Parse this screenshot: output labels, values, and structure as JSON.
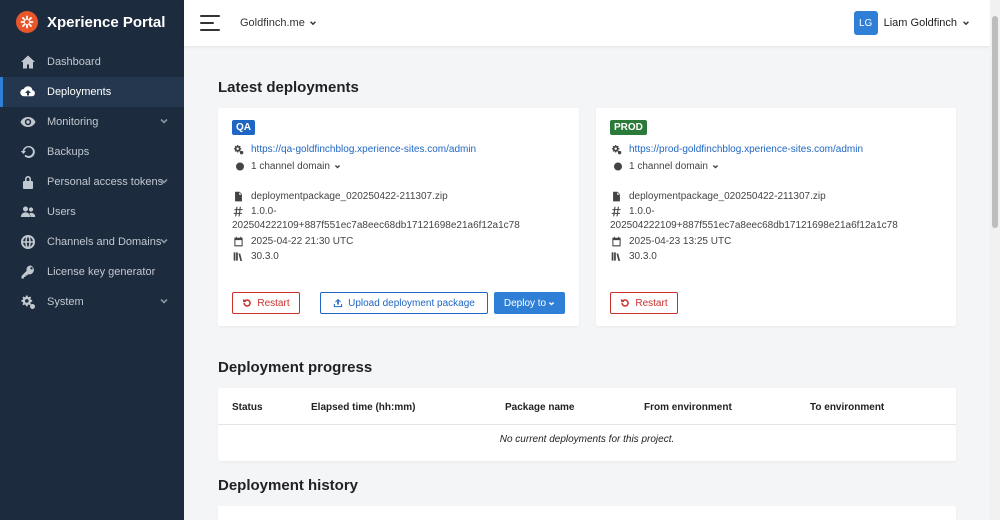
{
  "app": {
    "title": "Xperience Portal"
  },
  "sidebar": {
    "items": [
      {
        "label": "Dashboard",
        "icon": "home-icon",
        "active": false,
        "expandable": false
      },
      {
        "label": "Deployments",
        "icon": "cloud-upload-icon",
        "active": true,
        "expandable": false
      },
      {
        "label": "Monitoring",
        "icon": "eye-icon",
        "active": false,
        "expandable": true
      },
      {
        "label": "Backups",
        "icon": "restore-icon",
        "active": false,
        "expandable": false
      },
      {
        "label": "Personal access tokens",
        "icon": "lock-icon",
        "active": false,
        "expandable": true
      },
      {
        "label": "Users",
        "icon": "users-icon",
        "active": false,
        "expandable": false
      },
      {
        "label": "Channels and Domains",
        "icon": "globe-icon",
        "active": false,
        "expandable": true
      },
      {
        "label": "License key generator",
        "icon": "key-icon",
        "active": false,
        "expandable": false
      },
      {
        "label": "System",
        "icon": "gears-icon",
        "active": false,
        "expandable": true
      }
    ]
  },
  "topbar": {
    "project": "Goldfinch.me",
    "user_initials": "LG",
    "user_name": "Liam Goldfinch"
  },
  "deployments": {
    "title": "Latest deployments",
    "environments": [
      {
        "badge": "QA",
        "admin_url": "https://qa-goldfinchblog.xperience-sites.com/admin",
        "domains": "1 channel domain",
        "package": "deploymentpackage_020250422-211307.zip",
        "version_line1": "1.0.0-",
        "version_line2": "202504222109+887f551ec7a8eec68db17121698e21a6f12a1c78",
        "date": "2025-04-22 21:30 UTC",
        "xp_version": "30.3.0",
        "restart_label": "Restart",
        "upload_label": "Upload deployment package",
        "deploy_label": "Deploy to"
      },
      {
        "badge": "PROD",
        "admin_url": "https://prod-goldfinchblog.xperience-sites.com/admin",
        "domains": "1 channel domain",
        "package": "deploymentpackage_020250422-211307.zip",
        "version_line1": "1.0.0-",
        "version_line2": "202504222109+887f551ec7a8eec68db17121698e21a6f12a1c78",
        "date": "2025-04-23 13:25 UTC",
        "xp_version": "30.3.0",
        "restart_label": "Restart"
      }
    ]
  },
  "progress": {
    "title": "Deployment progress",
    "columns": [
      "Status",
      "Elapsed time (hh:mm)",
      "Package name",
      "From environment",
      "To environment"
    ],
    "empty_message": "No current deployments for this project."
  },
  "history": {
    "title": "Deployment history"
  },
  "colors": {
    "sidebar_bg": "#1d2b3e",
    "accent": "#2f7fd6",
    "brand_logo": "#e8572c",
    "qa_badge": "#1f66c4",
    "prod_badge": "#2b7a3a",
    "danger": "#c9302c"
  }
}
